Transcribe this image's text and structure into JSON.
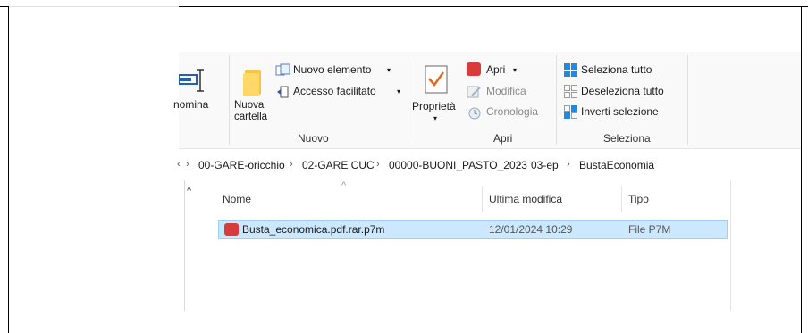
{
  "ribbon": {
    "rename_label_partial": "nomina",
    "new_folder_label_line1": "Nuova",
    "new_folder_label_line2": "cartella",
    "new_item_label": "Nuovo elemento",
    "easy_access_label": "Accesso facilitato",
    "group_new_label": "Nuovo",
    "properties_label": "Proprietà",
    "open_label": "Apri",
    "edit_label": "Modifica",
    "history_label": "Cronologia",
    "group_open_label": "Apri",
    "select_all_label": "Seleziona tutto",
    "select_none_label": "Deseleziona tutto",
    "invert_selection_label": "Inverti selezione",
    "group_select_label": "Seleziona"
  },
  "address": {
    "crumbs": [
      "00-GARE-oricchio",
      "02-GARE CUC",
      "00000-BUONI_PASTO_2023",
      "03-ep",
      "BustaEconomia"
    ]
  },
  "columns": {
    "name": "Nome",
    "modified": "Ultima modifica",
    "type": "Tipo"
  },
  "files": [
    {
      "name": "Busta_economica.pdf.rar.p7m",
      "modified": "12/01/2024 10:29",
      "type": "File P7M"
    }
  ],
  "icons": {
    "folder": "folder-icon",
    "properties": "checkmark-document-icon",
    "file": "p7m-file-icon"
  },
  "colors": {
    "selection_bg": "#cce8ff",
    "selection_border": "#99d1ff",
    "accent_blue": "#0078d4",
    "red_badge": "#d83b3b"
  }
}
